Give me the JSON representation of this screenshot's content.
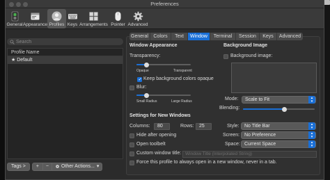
{
  "window": {
    "title": "Preferences"
  },
  "toolbar": {
    "items": [
      {
        "label": "General",
        "icon": "general-switch-icon"
      },
      {
        "label": "Appearance",
        "icon": "appearance-icon"
      },
      {
        "label": "Profiles",
        "icon": "profiles-person-icon",
        "selected": true
      },
      {
        "label": "Keys",
        "icon": "keys-keyboard-icon"
      },
      {
        "label": "Arrangements",
        "icon": "arrangements-grid-icon"
      },
      {
        "label": "Pointer",
        "icon": "pointer-mouse-icon"
      },
      {
        "label": "Advanced",
        "icon": "advanced-gear-icon"
      }
    ]
  },
  "sidebar": {
    "search_placeholder": "Search",
    "list_header": "Profile Name",
    "profiles": [
      {
        "label": "★ Default",
        "selected": true
      }
    ],
    "tags_button": "Tags >",
    "add_button": "+",
    "remove_button": "−",
    "other_actions_button": "Other Actions...",
    "other_actions_arrow": "▾"
  },
  "tabs": {
    "items": [
      "General",
      "Colors",
      "Text",
      "Window",
      "Terminal",
      "Session",
      "Keys",
      "Advanced"
    ],
    "active": "Window"
  },
  "window_appearance": {
    "title": "Window Appearance",
    "transparency_label": "Transparency:",
    "transparency_min": "Opaque",
    "transparency_max": "Transparent",
    "transparency_value": 0.18,
    "keep_bg_opaque_label": "Keep background colors opaque",
    "keep_bg_opaque_checked": true,
    "blur_label": "Blur:",
    "blur_checked": false,
    "blur_min": "Small Radius",
    "blur_max": "Large Radius",
    "blur_value": 0.18
  },
  "background_image": {
    "title": "Background Image",
    "checkbox_label": "Background image:",
    "checked": false,
    "mode_label": "Mode:",
    "mode_value": "Scale to Fit",
    "blending_label": "Blending:",
    "blending_value": 0.58
  },
  "new_windows": {
    "title": "Settings for New Windows",
    "columns_label": "Columns:",
    "columns_value": "80",
    "rows_label": "Rows:",
    "rows_value": "25",
    "hide_after_opening_label": "Hide after opening",
    "open_toolbelt_label": "Open toolbelt",
    "custom_title_label": "Custom window title:",
    "custom_title_placeholder": "Window Title (Interpolated String)",
    "force_new_window_label": "Force this profile to always open in a new window, never in a tab.",
    "style_label": "Style:",
    "style_value": "No Title Bar",
    "screen_label": "Screen:",
    "screen_value": "No Preference",
    "space_label": "Space:",
    "space_value": "Current Space"
  },
  "colors": {
    "accent": "#1a6fd6",
    "window_bg": "#2b2b2b",
    "panel_bg": "#303030"
  }
}
